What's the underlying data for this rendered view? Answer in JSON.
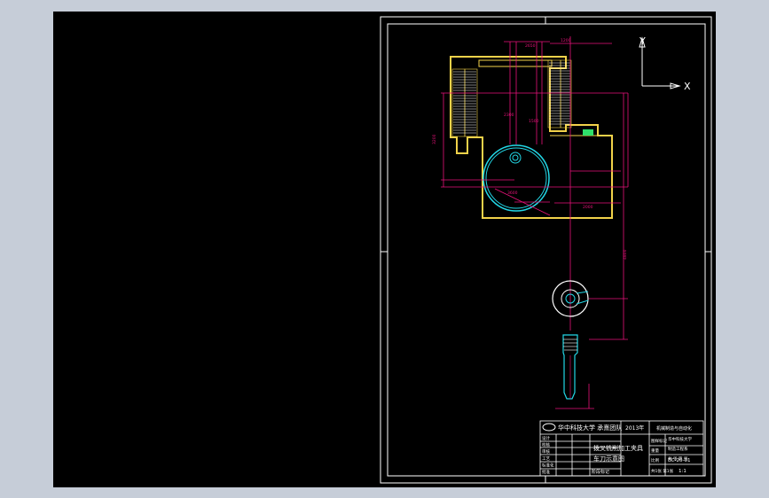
{
  "colors": {
    "background": "#c6cdd8",
    "canvas": "#000000",
    "frame": "#ffffff",
    "outline": "#f2d24a",
    "dimension": "#e8127a",
    "circle": "#22d7e6",
    "green": "#2fe06a",
    "hatch": "#ffffff"
  },
  "ucs": {
    "x_label": "X",
    "y_label": "Y"
  },
  "title_block": {
    "school": "华中科技大学 承熹团队",
    "date": "2013年",
    "company_line": "机械制造与自动化",
    "drawing_title_line1": "拨叉铣削加工夹具",
    "drawing_title_line2": "车刀示意图",
    "row_labels": [
      "设计",
      "校核",
      "审核",
      "工艺",
      "标准化",
      "批准"
    ],
    "right_labels": [
      "图样标记",
      "重量",
      "比例"
    ],
    "right_values": [
      "华中科技大学",
      "制造工程系",
      "共 张 第 张"
    ],
    "drawing_number": "BC-20-01",
    "scale": "1:1",
    "sheet_note": "共1张 第1张",
    "footer": "阶段标记"
  },
  "dimensions": [
    "3200",
    "2650",
    "1200",
    "4800",
    "2300",
    "1500",
    "3600",
    "2000"
  ]
}
